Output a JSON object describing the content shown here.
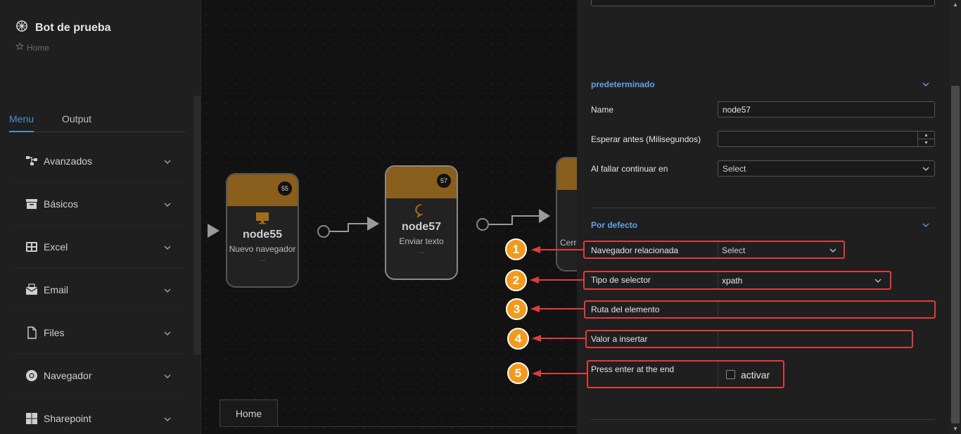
{
  "app": {
    "bot_title": "Bot de prueba",
    "breadcrumb": "Home"
  },
  "sidebar": {
    "tabs": [
      {
        "label": "Menu",
        "active": true
      },
      {
        "label": "Output",
        "active": false
      }
    ],
    "items": [
      {
        "label": "Avanzados",
        "icon": "flow-icon"
      },
      {
        "label": "Básicos",
        "icon": "archive-icon"
      },
      {
        "label": "Excel",
        "icon": "table-icon"
      },
      {
        "label": "Email",
        "icon": "email-icon"
      },
      {
        "label": "Files",
        "icon": "file-icon"
      },
      {
        "label": "Navegador",
        "icon": "chrome-icon"
      },
      {
        "label": "Sharepoint",
        "icon": "windows-icon"
      }
    ]
  },
  "canvas": {
    "nodes": [
      {
        "id": "55",
        "name": "node55",
        "subtitle": "Nuevo navegador",
        "more": "...",
        "icon": "monitor-icon"
      },
      {
        "id": "57",
        "name": "node57",
        "subtitle": "Enviar texto",
        "more": "...",
        "icon": "chat-icon"
      },
      {
        "subtitle": "Cerr"
      }
    ],
    "tab_label": "Home"
  },
  "panel": {
    "section1": {
      "title": "predeterminado",
      "name_label": "Name",
      "name_value": "node57",
      "wait_label": "Esperar antes (Milisegundos)",
      "wait_value": "",
      "onfail_label": "Al fallar continuar en",
      "onfail_value": "Select"
    },
    "section2": {
      "title": "Por defecto",
      "browser_label": "Navegador relacionada",
      "browser_value": "Select",
      "selector_type_label": "Tipo de selector",
      "selector_type_value": "xpath",
      "element_path_label": "Ruta del elemento",
      "element_path_value": "",
      "insert_value_label": "Valor a insertar",
      "insert_value_value": "",
      "press_enter_label": "Press enter at the end",
      "press_enter_checkbox_label": "activar",
      "press_enter_checked": false
    }
  },
  "annotations": {
    "numbers": [
      "1",
      "2",
      "3",
      "4",
      "5"
    ],
    "accent_color": "#e23b3b",
    "circle_color": "#f29a1b"
  },
  "colors": {
    "node_header": "#8a5e1c",
    "section_title": "#5fa4e8",
    "active_tab": "#4c8fd6"
  }
}
